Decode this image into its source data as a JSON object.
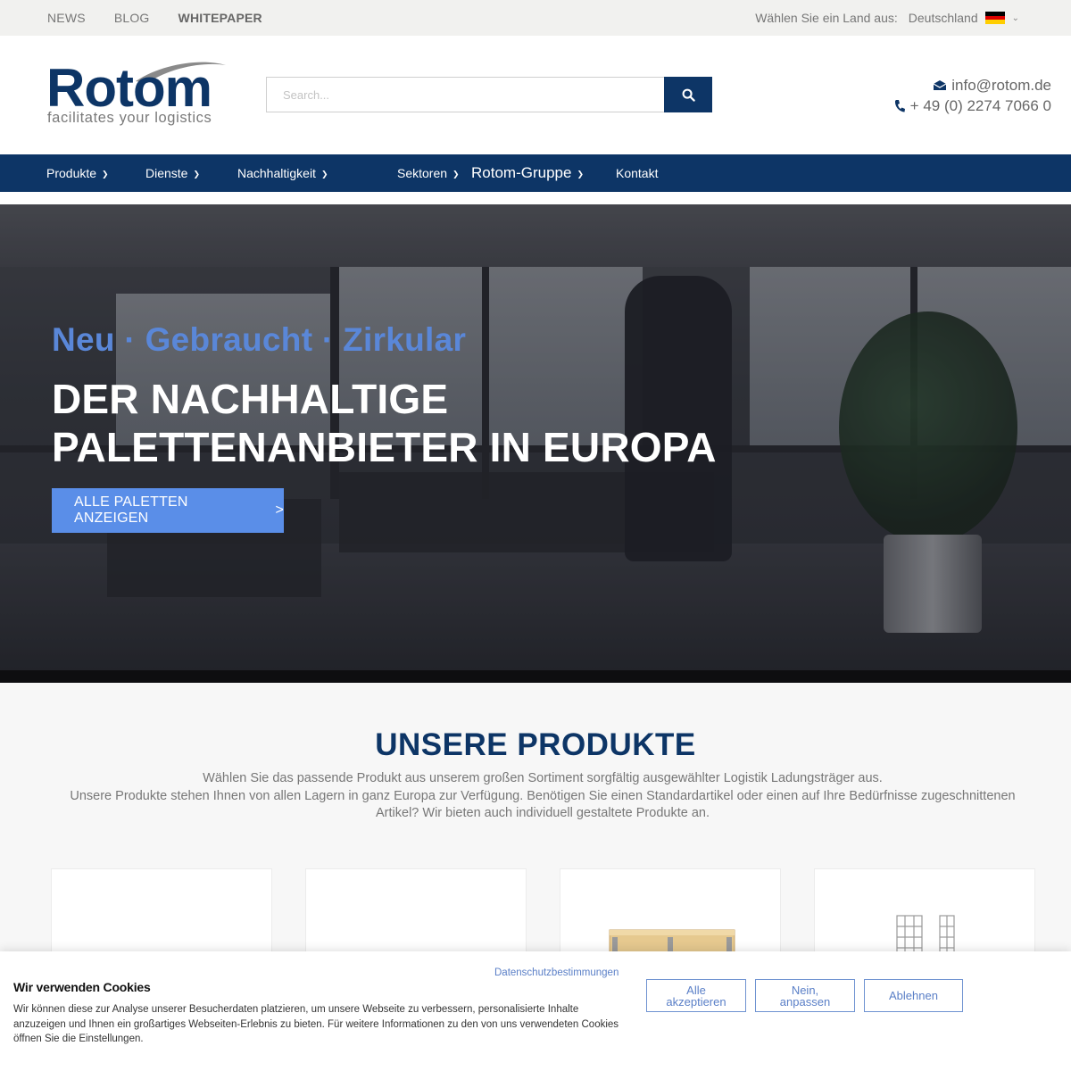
{
  "topbar": {
    "nav": [
      "NEWS",
      "BLOG",
      "WHITEPAPER"
    ],
    "country_prompt": "Wählen Sie ein Land aus:",
    "country_value": "Deutschland",
    "flag_colors": [
      "#000000",
      "#dd0000",
      "#ffce00"
    ]
  },
  "header": {
    "logo_word": "Rotom",
    "logo_tagline": "facilitates your logistics",
    "search_placeholder": "Search...",
    "email": "info@rotom.de",
    "phone": "+ 49 (0) 2274 7066 0"
  },
  "mainnav": {
    "items": [
      {
        "label": "Produkte",
        "has_dropdown": true
      },
      {
        "label": "Dienste",
        "has_dropdown": true
      },
      {
        "label": "Nachhaltigkeit",
        "has_dropdown": true
      },
      {
        "label": "Sektoren",
        "has_dropdown": true
      },
      {
        "label": "Rotom-Gruppe",
        "has_dropdown": true
      },
      {
        "label": "Kontakt",
        "has_dropdown": false
      }
    ]
  },
  "hero": {
    "subtitle": "Neu · Gebraucht · Zirkular",
    "title": "DER NACHHALTIGE PALETTENANBIETER IN EUROPA",
    "button_label": "ALLE PALETTEN ANZEIGEN",
    "button_arrow": ">"
  },
  "products": {
    "title": "UNSERE PRODUKTE",
    "line1": "Wählen Sie das passende Produkt aus unserem großen Sortiment sorgfältig ausgewählter Logistik Ladungsträger aus.",
    "line2": "Unsere Produkte stehen Ihnen von allen Lagern in ganz Europa zur Verfügung. Benötigen Sie einen Standardartikel oder einen auf Ihre Bedürfnisse zugeschnittenen Artikel? Wir bieten auch individuell gestaltete Produkte an."
  },
  "cookie": {
    "privacy_link": "Datenschutzbestimmungen",
    "title": "Wir verwenden Cookies",
    "text": "Wir können diese zur Analyse unserer Besucherdaten platzieren, um unsere Webseite zu verbessern, personalisierte Inhalte anzuzeigen und Ihnen ein großartiges Webseiten-Erlebnis zu bieten. Für weitere Informationen zu den von uns verwendeten Cookies öffnen Sie die Einstellungen.",
    "accept_all": "Alle akzeptieren",
    "customize": "Nein, anpassen",
    "decline": "Ablehnen"
  },
  "colors": {
    "brand_navy": "#0d3566",
    "accent_blue": "#5a8ee8",
    "subtitle_blue": "#5a87d8",
    "link_blue": "#5a7fc7"
  }
}
